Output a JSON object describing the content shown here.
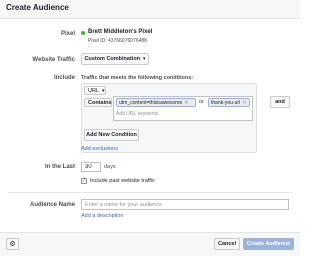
{
  "dialog": {
    "title": "Create Audience"
  },
  "pixel": {
    "label": "Pixel",
    "name": "Brett Middleton's Pixel",
    "id_text": "Pixel ID: 437660760764​88",
    "status_color": "#42b72a"
  },
  "website_traffic": {
    "label": "Website Traffic",
    "selected": "Custom Combination"
  },
  "include": {
    "label": "Include",
    "condition_text": "Traffic that meets the following conditions:",
    "url_select": "URL",
    "operator_select": "Contains",
    "keywords": [
      "utm_content=thisisawesome",
      "thank-you-url"
    ],
    "or_text": "or",
    "and_button": "and",
    "keyword_placeholder": "Add URL keywords",
    "add_condition_button": "Add New Condition",
    "add_exclusions_link": "Add exclusions"
  },
  "in_the_last": {
    "label": "In the Last",
    "value": "30",
    "unit": "days",
    "include_past_checked": true,
    "include_past_label": "Include past website traffic"
  },
  "audience_name": {
    "label": "Audience Name",
    "placeholder": "Enter a name for your audience",
    "value": "",
    "add_description_link": "Add a description"
  },
  "footer": {
    "cancel_button": "Cancel",
    "create_button": "Create Audience"
  },
  "colors": {
    "link": "#4267b2",
    "primary_button_disabled": "#9cb4d8",
    "chip_border": "#9cb4d8"
  }
}
